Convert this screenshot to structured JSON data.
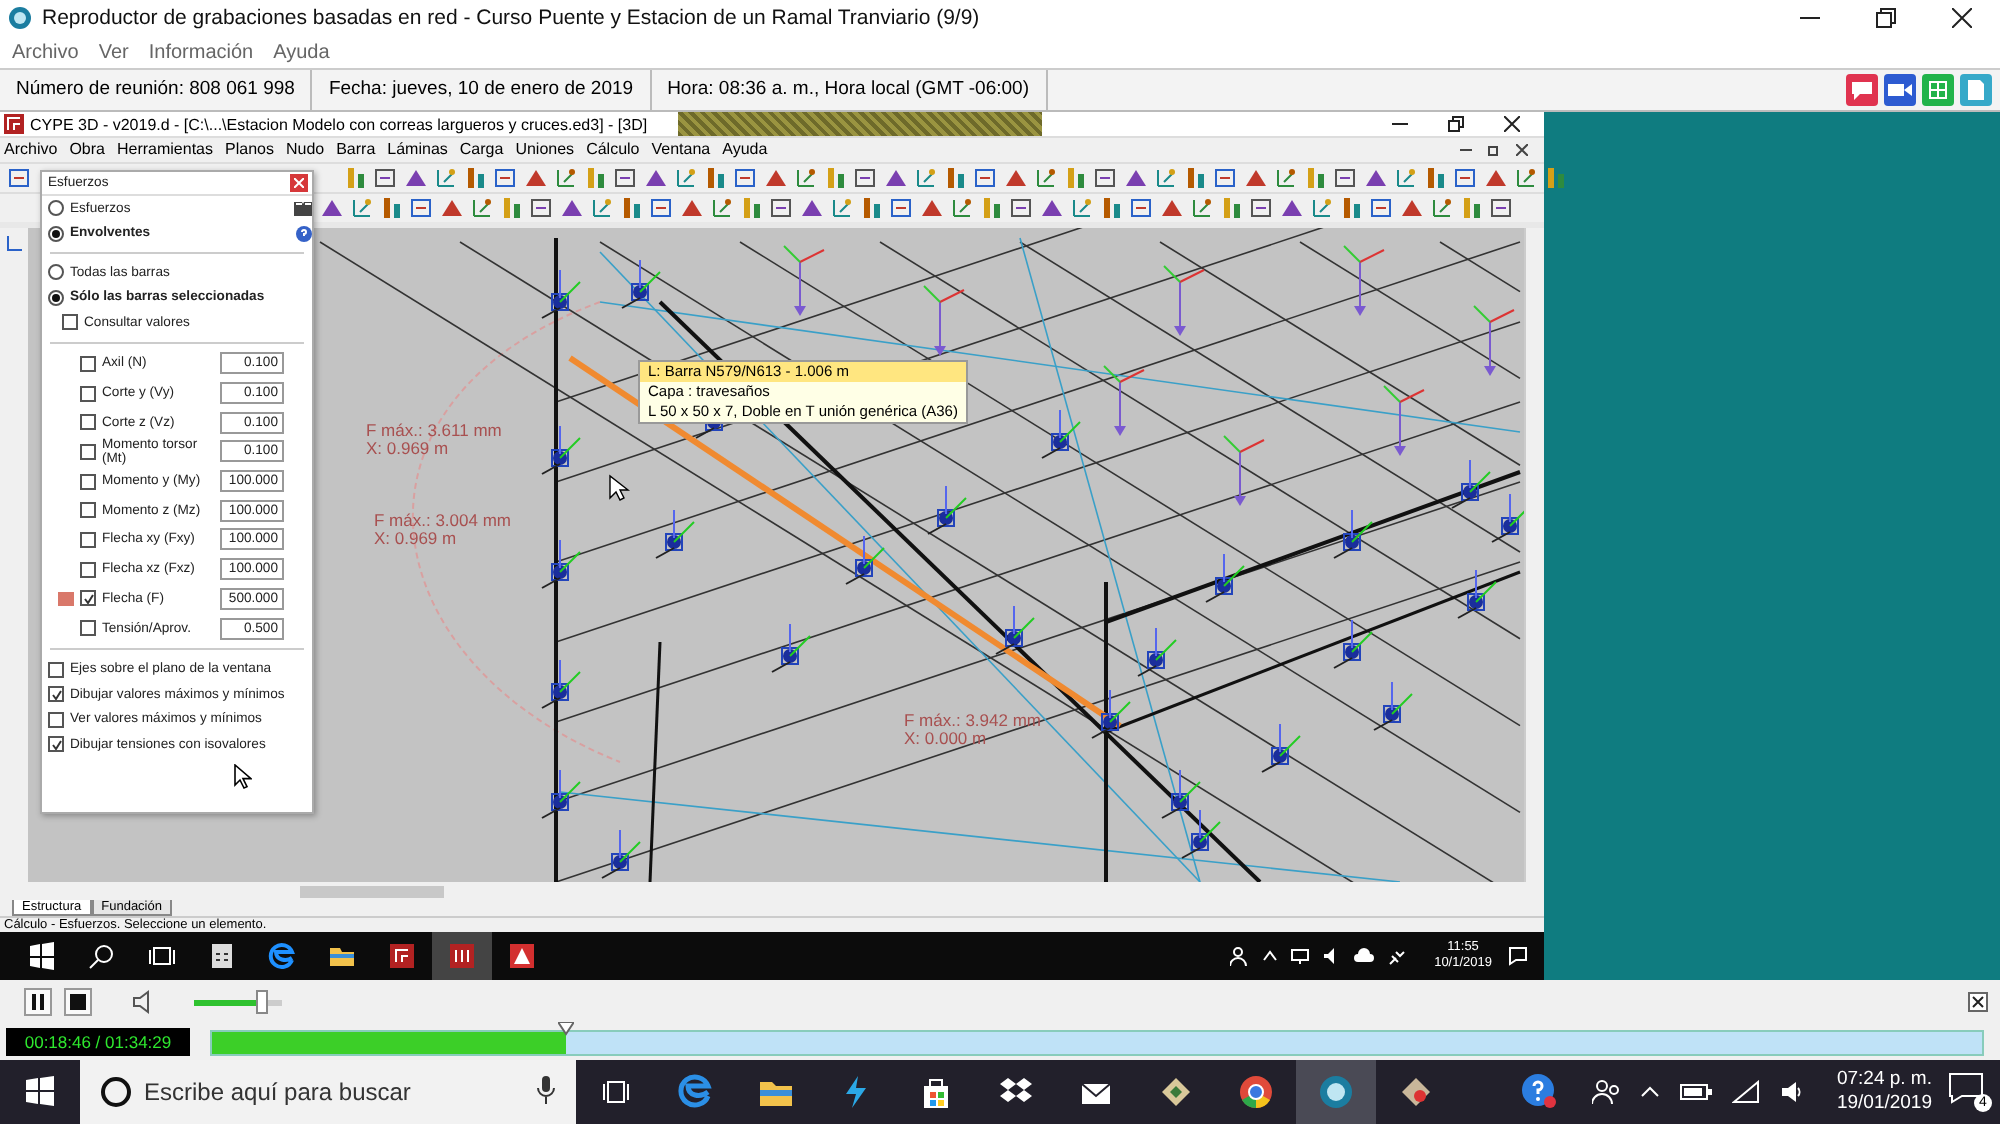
{
  "recorder": {
    "title": "Reproductor de grabaciones basadas en red - Curso Puente y Estacion de un Ramal Tranviario (9/9)",
    "menu": [
      "Archivo",
      "Ver",
      "Información",
      "Ayuda"
    ],
    "info": [
      "Número de reunión: 808 061 998",
      "Fecha: jueves, 10 de enero de 2019",
      "Hora: 08:36 a. m., Hora local (GMT -06:00)"
    ]
  },
  "cype": {
    "title": "CYPE 3D - v2019.d - [C:\\...\\Estacion Modelo con correas largueros y cruces.ed3] - [3D]",
    "menu": [
      "Archivo",
      "Obra",
      "Herramientas",
      "Planos",
      "Nudo",
      "Barra",
      "Láminas",
      "Carga",
      "Uniones",
      "Cálculo",
      "Ventana",
      "Ayuda"
    ],
    "tabs": [
      {
        "label": "Estructura",
        "selected": true
      },
      {
        "label": "Fundación",
        "selected": false
      }
    ],
    "status": "Cálculo - Esfuerzos. Seleccione un elemento.",
    "taskbar": {
      "time": "11:55",
      "date": "10/1/2019"
    }
  },
  "dialog": {
    "title": "Esfuerzos",
    "mode": [
      {
        "label": "Esfuerzos",
        "selected": false
      },
      {
        "label": "Envolventes",
        "selected": true
      }
    ],
    "scope": [
      {
        "label": "Todas las barras",
        "selected": false
      },
      {
        "label": "Sólo las barras seleccionadas",
        "selected": true
      }
    ],
    "consult": {
      "label": "Consultar valores",
      "checked": false
    },
    "rows": [
      {
        "label": "Axil (N)",
        "checked": false,
        "value": "0.100"
      },
      {
        "label": "Corte y (Vy)",
        "checked": false,
        "value": "0.100"
      },
      {
        "label": "Corte z (Vz)",
        "checked": false,
        "value": "0.100"
      },
      {
        "label": "Momento torsor (Mt)",
        "checked": false,
        "value": "0.100"
      },
      {
        "label": "Momento y (My)",
        "checked": false,
        "value": "100.000"
      },
      {
        "label": "Momento z (Mz)",
        "checked": false,
        "value": "100.000"
      },
      {
        "label": "Flecha xy (Fxy)",
        "checked": false,
        "value": "100.000"
      },
      {
        "label": "Flecha xz (Fxz)",
        "checked": false,
        "value": "100.000"
      },
      {
        "label": "Flecha (F)",
        "checked": true,
        "value": "500.000",
        "color": "#d9786a"
      },
      {
        "label": "Tensión/Aprov.",
        "checked": false,
        "value": "0.500"
      }
    ],
    "options": [
      {
        "label": "Ejes sobre el plano de la ventana",
        "checked": false
      },
      {
        "label": "Dibujar valores máximos y mínimos",
        "checked": true
      },
      {
        "label": "Ver valores máximos y mínimos",
        "checked": false
      },
      {
        "label": "Dibujar tensiones con isovalores",
        "checked": true
      }
    ]
  },
  "tooltip": [
    "L: Barra N579/N613 - 1.006 m",
    "Capa : travesaños",
    "L 50 x 50 x 7, Doble en T unión genérica (A36)"
  ],
  "labels": [
    {
      "lines": [
        "F máx.: 3.611 mm",
        "X: 0.969 m"
      ]
    },
    {
      "lines": [
        "F máx.: 3.004 mm",
        "X: 0.969 m"
      ]
    },
    {
      "lines": [
        "F máx.: 3.942 mm",
        "X: 0.000 m"
      ]
    }
  ],
  "player": {
    "volume": {
      "level": 0.78
    },
    "time": "00:18:46 / 01:34:29",
    "progress": {
      "level": 0.2
    }
  },
  "taskbar": {
    "search_placeholder": "Escribe aquí para buscar",
    "time": "07:24 p. m.",
    "date": "19/01/2019",
    "notifications": "4"
  }
}
